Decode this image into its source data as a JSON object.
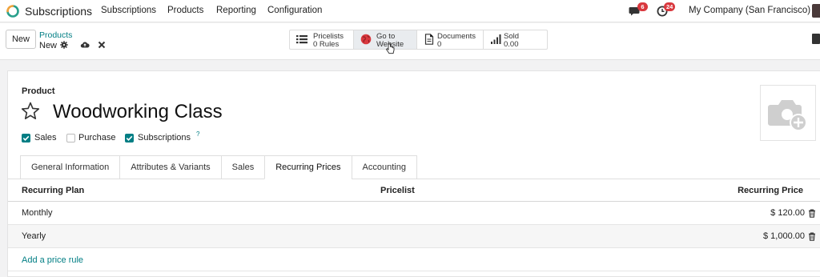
{
  "navbar": {
    "app_name": "Subscriptions",
    "menu": [
      "Subscriptions",
      "Products",
      "Reporting",
      "Configuration"
    ],
    "messages_count": "6",
    "activities_count": "24",
    "company": "My Company (San Francisco)"
  },
  "controlbar": {
    "new_label": "New",
    "breadcrumb_parent": "Products",
    "breadcrumb_current": "New",
    "smart_buttons": [
      {
        "line1": "Pricelists",
        "line2": "0  Rules",
        "icon": "list-icon"
      },
      {
        "line1": "Go to",
        "line2": "Website",
        "icon": "globe-icon"
      },
      {
        "line1": "Documents",
        "line2": "0",
        "icon": "document-icon"
      },
      {
        "line1": "Sold",
        "line2": "0.00",
        "icon": "signal-icon"
      }
    ]
  },
  "form": {
    "product_label": "Product",
    "product_name": "Woodworking Class",
    "checkboxes": [
      {
        "label": "Sales",
        "checked": true
      },
      {
        "label": "Purchase",
        "checked": false
      },
      {
        "label": "Subscriptions",
        "checked": true
      }
    ],
    "subscriptions_help": "?",
    "tabs": [
      "General Information",
      "Attributes & Variants",
      "Sales",
      "Recurring Prices",
      "Accounting"
    ],
    "active_tab": "Recurring Prices",
    "table": {
      "headers": {
        "plan": "Recurring Plan",
        "pricelist": "Pricelist",
        "price": "Recurring Price"
      },
      "rows": [
        {
          "plan": "Monthly",
          "pricelist": "",
          "price": "$ 120.00"
        },
        {
          "plan": "Yearly",
          "pricelist": "",
          "price": "$ 1,000.00"
        }
      ],
      "add_line": "Add a price rule"
    }
  },
  "colors": {
    "accent": "#017e84",
    "badge": "#d9383e",
    "logo_green": "#28a08c",
    "logo_orange": "#f0a33c"
  }
}
